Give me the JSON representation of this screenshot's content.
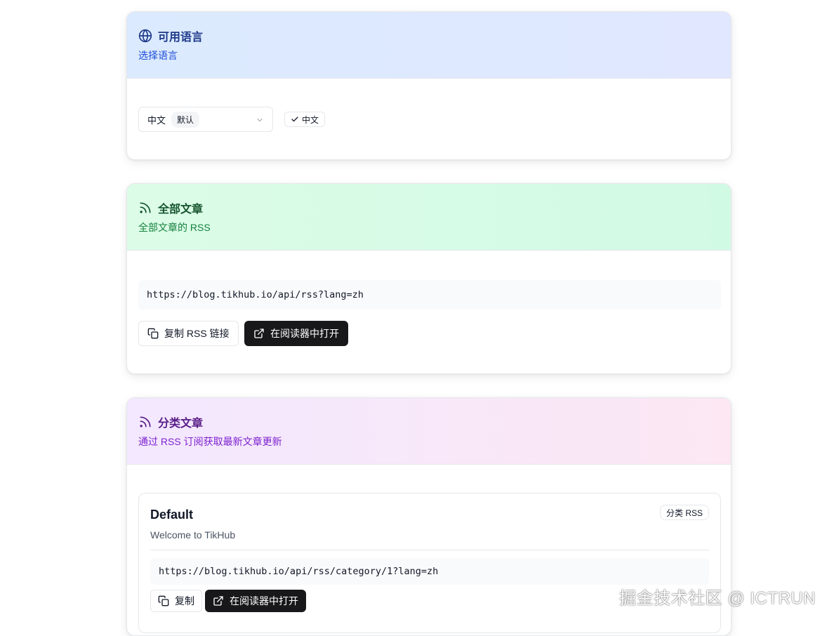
{
  "language_card": {
    "title": "可用语言",
    "subtitle": "选择语言",
    "select_value": "中文",
    "select_badge": "默认",
    "selected_pill": "中文",
    "icon": "globe-icon"
  },
  "all_articles_card": {
    "title": "全部文章",
    "subtitle": "全部文章的 RSS",
    "rss_url": "https://blog.tikhub.io/api/rss?lang=zh",
    "copy_button": "复制 RSS 链接",
    "open_button": "在阅读器中打开",
    "icon": "rss-icon"
  },
  "category_card": {
    "title": "分类文章",
    "subtitle": "通过 RSS 订阅获取最新文章更新",
    "icon": "rss-icon",
    "categories": [
      {
        "name": "Default",
        "description": "Welcome to TikHub",
        "badge": "分类 RSS",
        "rss_url": "https://blog.tikhub.io/api/rss/category/1?lang=zh",
        "copy_button": "复制",
        "open_button": "在阅读器中打开"
      }
    ]
  },
  "watermark": "掘金技术社区 @ ICTRUN",
  "colors": {
    "blue_title": "#1e3a8a",
    "green_title": "#14532d",
    "purple_title": "#581c87",
    "dark_button": "#18181b"
  }
}
